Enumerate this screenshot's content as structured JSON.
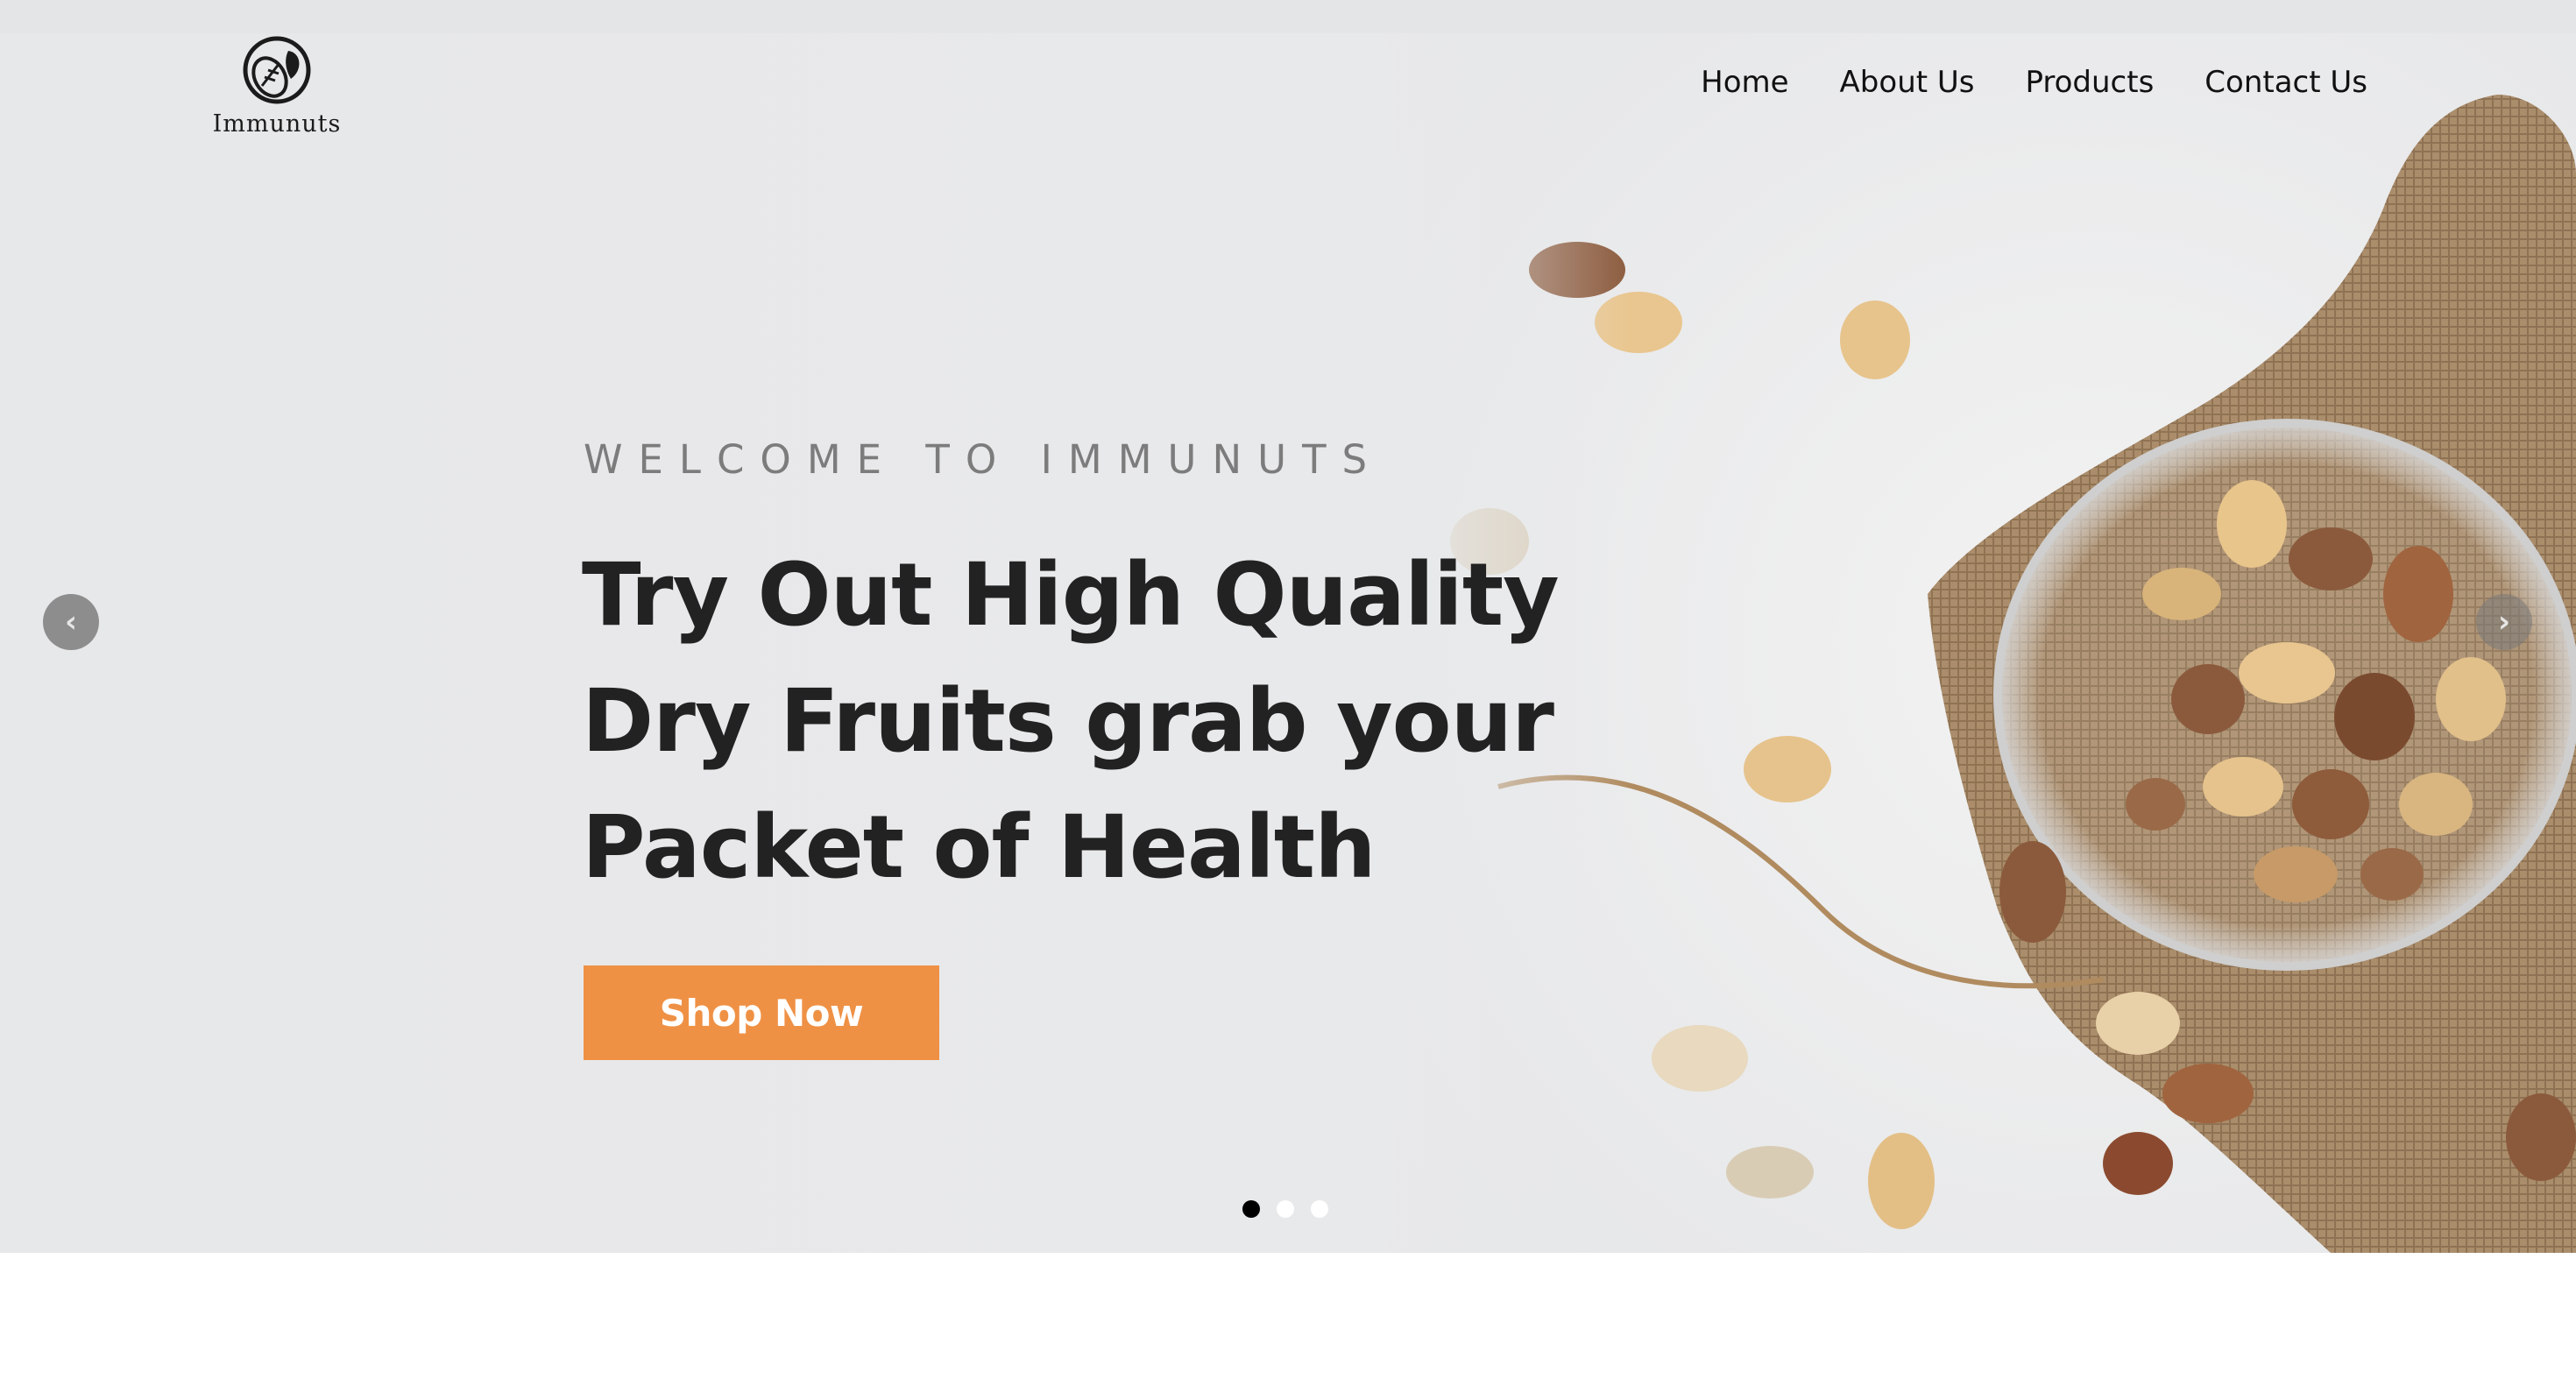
{
  "brand": {
    "name": "Immunuts",
    "logo_icon": "almond-leaf-logo-icon"
  },
  "nav": {
    "items": [
      {
        "label": "Home"
      },
      {
        "label": "About Us"
      },
      {
        "label": "Products"
      },
      {
        "label": "Contact Us"
      }
    ]
  },
  "hero": {
    "eyebrow": "WELCOME TO IMMUNUTS",
    "headline_lines": [
      "Try Out High Quality",
      "Dry Fruits grab your",
      "Packet of Health"
    ],
    "cta_label": "Shop Now",
    "cta_color": "#ef9145",
    "prev_icon": "chevron-left-icon",
    "next_icon": "chevron-right-icon",
    "slides_total": 3,
    "active_slide": 1
  },
  "colors": {
    "hero_bg": "#e7e8ea",
    "headline": "#222222",
    "eyebrow": "#7c7c7c",
    "accent": "#ef9145"
  }
}
